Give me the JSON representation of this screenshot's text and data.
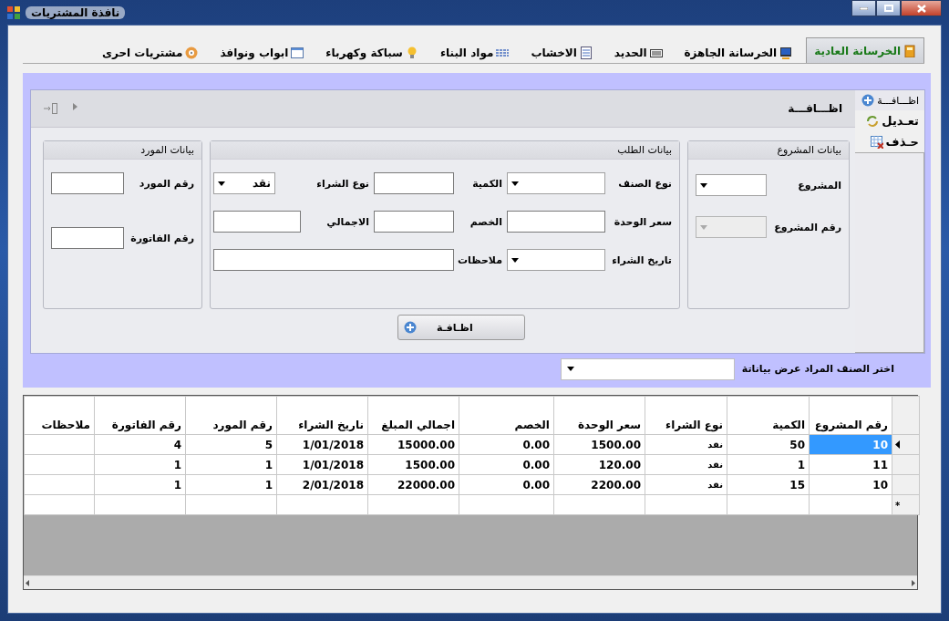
{
  "window": {
    "title": "نافذة المشتريات"
  },
  "tabs": [
    {
      "label": "الخرسانة العادية",
      "selected": true
    },
    {
      "label": "الخرسانة الجاهزة",
      "selected": false
    },
    {
      "label": "الحديد",
      "selected": false
    },
    {
      "label": "الاخشاب",
      "selected": false
    },
    {
      "label": "مواد البناء",
      "selected": false
    },
    {
      "label": "سباكة وكهرباء",
      "selected": false
    },
    {
      "label": "ابواب ونوافذ",
      "selected": false
    },
    {
      "label": "مشتريات احرى",
      "selected": false
    }
  ],
  "side_tabs": [
    {
      "label": "اظـــافـــة",
      "selected": true
    },
    {
      "label": "تعـديل",
      "selected": false
    },
    {
      "label": "حـذف",
      "selected": false
    }
  ],
  "panel_title": "اظـــافـــة",
  "groups": [
    {
      "title": "بيانات المشروع",
      "fields": [
        {
          "label": "المشروع",
          "kind": "combo",
          "disabled": false
        },
        {
          "label": "رقم  المشروع",
          "kind": "combo",
          "disabled": true
        }
      ]
    },
    {
      "title": "بيانات الطلب",
      "fields": [
        {
          "label": "نوع الصنف",
          "kind": "combo"
        },
        {
          "label": "الكمية",
          "kind": "text"
        },
        {
          "label": "نوع الشراء",
          "kind": "combo",
          "value": "نقد"
        },
        {
          "label": "سعر الوحدة",
          "kind": "text"
        },
        {
          "label": "الخصم",
          "kind": "text"
        },
        {
          "label": "الاجمالي",
          "kind": "text"
        },
        {
          "label": "تاريخ الشراء",
          "kind": "combo"
        },
        {
          "label": "ملاحظات",
          "kind": "wide"
        }
      ]
    },
    {
      "title": "بيانات المورد",
      "fields": [
        {
          "label": "رقم المورد",
          "kind": "text"
        },
        {
          "label": "رقم الفاتورة",
          "kind": "text"
        }
      ]
    }
  ],
  "add_button": "اظـافـة",
  "filter": {
    "label": "اختر الصنف المراد عرض بياناتة"
  },
  "table": {
    "columns": [
      "رقم المشروع",
      "الكمية",
      "نوع الشراء",
      "سعر الوحدة",
      "الخصم",
      "اجمالي المبلغ",
      "ناريخ الشراء",
      "رقم المورد",
      "رقم الفاتورة",
      "ملاحظات"
    ],
    "rows": [
      {
        "current": true,
        "selected": true,
        "cells": [
          "10",
          "50",
          "نقد",
          "1500.00",
          "0.00",
          "15000.00",
          "1/01/2018",
          "5",
          "4",
          ""
        ]
      },
      {
        "current": false,
        "selected": false,
        "cells": [
          "11",
          "1",
          "نقد",
          "120.00",
          "0.00",
          "1500.00",
          "1/01/2018",
          "1",
          "1",
          ""
        ]
      },
      {
        "current": false,
        "selected": false,
        "cells": [
          "10",
          "15",
          "نقد",
          "2200.00",
          "0.00",
          "22000.00",
          "2/01/2018",
          "1",
          "1",
          ""
        ]
      }
    ],
    "new_row_marker": "*"
  }
}
